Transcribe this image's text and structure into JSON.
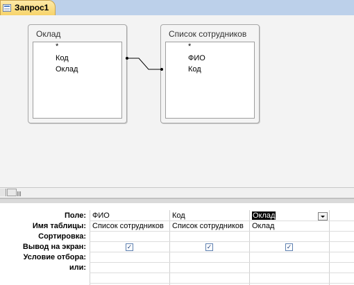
{
  "tab": {
    "label": "Запрос1"
  },
  "tables": [
    {
      "title": "Оклад",
      "fields": [
        "*",
        "Код",
        "Оклад"
      ]
    },
    {
      "title": "Список сотрудников",
      "fields": [
        "*",
        "ФИО",
        "Код"
      ]
    }
  ],
  "grid": {
    "row_labels": [
      "Поле:",
      "Имя таблицы:",
      "Сортировка:",
      "Вывод на экран:",
      "Условие отбора:",
      "или:"
    ],
    "columns": [
      {
        "field": "ФИО",
        "table": "Список сотрудников",
        "sort": "",
        "show": true,
        "criteria": "",
        "or": ""
      },
      {
        "field": "Код",
        "table": "Список сотрудников",
        "sort": "",
        "show": true,
        "criteria": "",
        "or": ""
      },
      {
        "field": "Оклад",
        "table": "Оклад",
        "sort": "",
        "show": true,
        "criteria": "",
        "or": ""
      }
    ],
    "check_glyph": "✓"
  }
}
